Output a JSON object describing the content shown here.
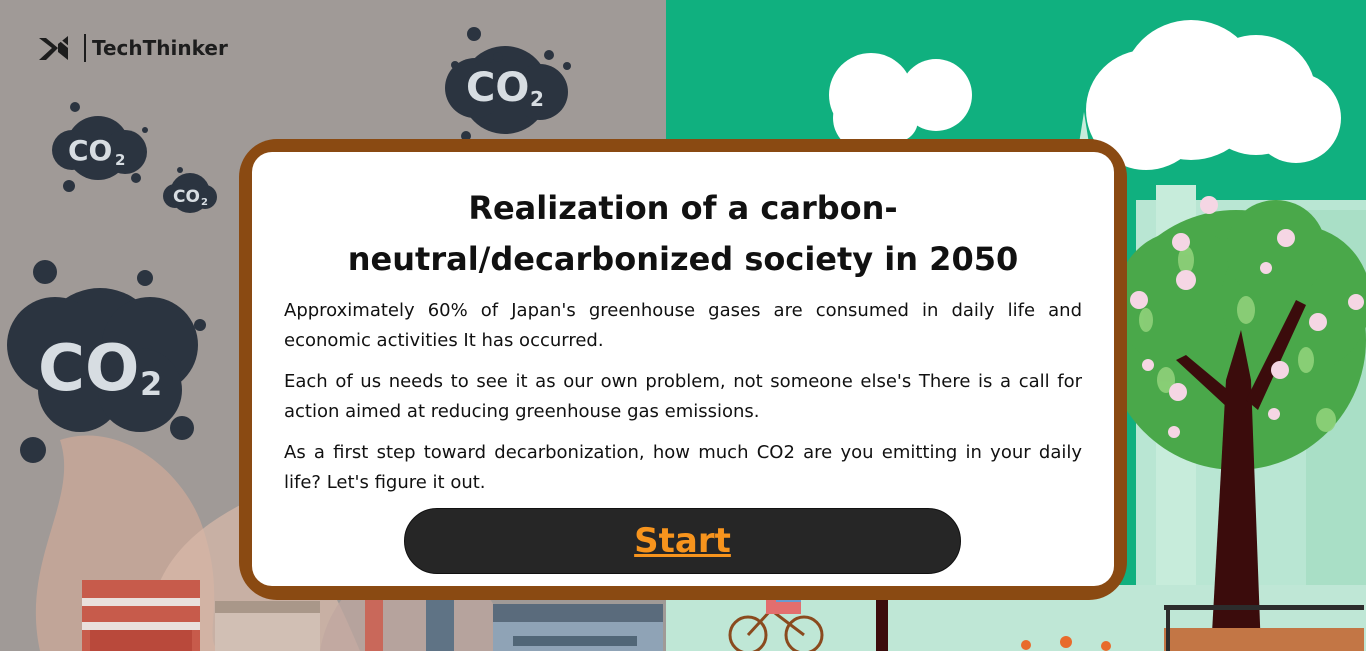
{
  "brand": {
    "name": "TechThinker",
    "logo_icon": "x-arrow-logo-icon"
  },
  "background": {
    "left_color": "#a09a97",
    "right_color": "#10b07f",
    "co2_label": "CO",
    "co2_subscript": "2"
  },
  "modal": {
    "frame_color": "#8a4a12",
    "title_line1": "Realization of a carbon-",
    "title_line2": "neutral/decarbonized society in 2050",
    "paragraphs": [
      "Approximately 60% of Japan's greenhouse gases are consumed in daily life and economic activities It has occurred.",
      "Each of us needs to see it as our own problem, not someone else's There is a call for action aimed at reducing greenhouse gas emissions.",
      "As a first step toward decarbonization, how much CO2 are you emitting in your daily life? Let's figure it out."
    ],
    "start_label": "Start",
    "start_color": "#f7941d"
  }
}
